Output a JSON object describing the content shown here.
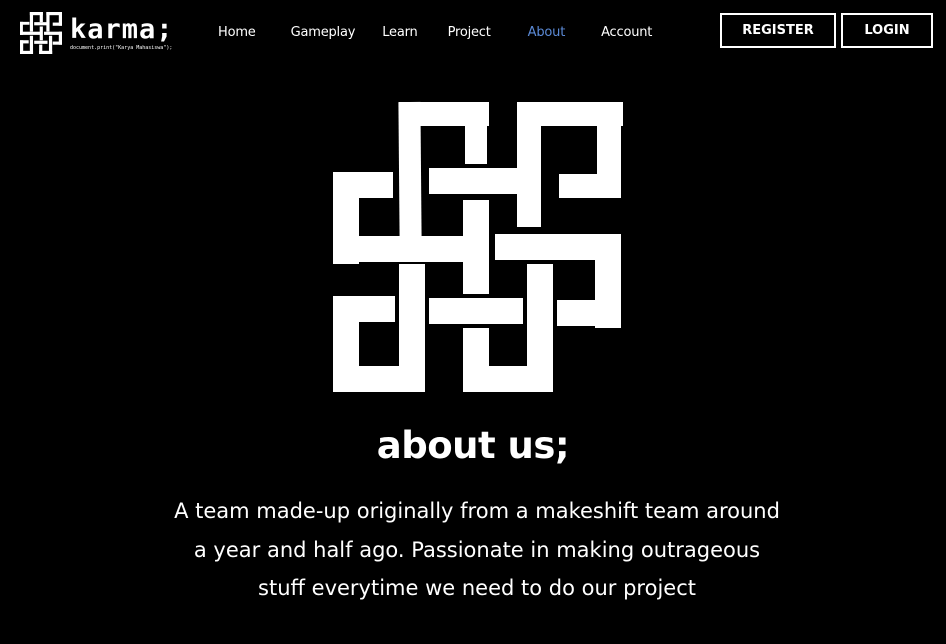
{
  "brand": {
    "name": "karma;",
    "tagline": "document.print(\"Karya Mahasiswa\");"
  },
  "nav": {
    "items": [
      {
        "label": "Home",
        "active": false
      },
      {
        "label": "Gameplay",
        "active": false
      },
      {
        "label": "Learn",
        "active": false
      },
      {
        "label": "Project",
        "active": false
      },
      {
        "label": "About",
        "active": true
      },
      {
        "label": "Account",
        "active": false
      }
    ]
  },
  "auth": {
    "register_label": "REGISTER",
    "login_label": "LOGIN"
  },
  "hero": {
    "logo_icon": "endless-knot-icon",
    "title": "about us;",
    "description": "A team made-up originally from a makeshift team around a year and half ago. Passionate in making outrageous stuff everytime we need to do our project"
  },
  "colors": {
    "background": "#000000",
    "text": "#ffffff",
    "active_nav": "#5b8ad6"
  }
}
